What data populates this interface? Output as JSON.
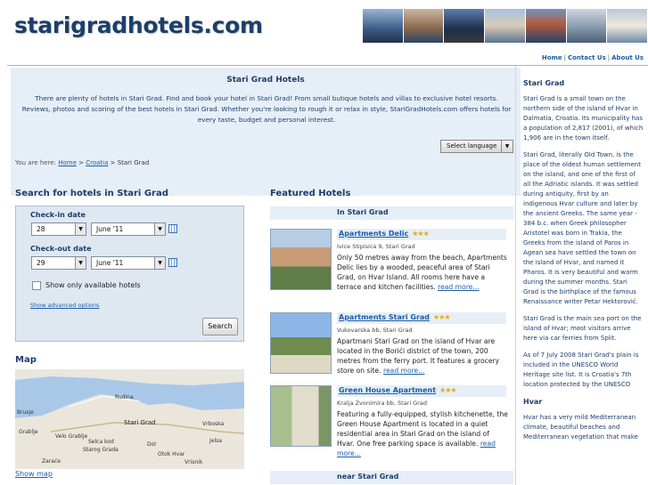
{
  "header": {
    "logo": "starigradhotels.com",
    "nav": [
      "Home",
      "Contact Us",
      "About Us"
    ]
  },
  "intro": {
    "title": "Stari Grad Hotels",
    "text": "There are plenty of hotels in Stari Grad. Find and book your hotel in Stari Grad! From small butique hotels and villas to exclusive hotel resorts. Reviews, photos and scoring of the best hotels in Stari Grad. Whether you're looking to rough it or relax in style, StariGradHotels.com offers hotels for every taste, budget and personal interest."
  },
  "language": {
    "label": "Select language"
  },
  "breadcrumb": {
    "label": "You are here:",
    "home": "Home",
    "country": "Croatia",
    "current": "Stari Grad"
  },
  "search": {
    "title": "Search for hotels in Stari Grad",
    "checkin_label": "Check-in date",
    "checkin_day": "28",
    "checkin_month": "June '11",
    "checkout_label": "Check-out date",
    "checkout_day": "29",
    "checkout_month": "June '11",
    "available_label": "Show only available hotels",
    "advanced_link": "Show advanced options",
    "button": "Search"
  },
  "map": {
    "title": "Map",
    "labels": [
      "Rudina",
      "Brusje",
      "Stari Grad",
      "Vrboska",
      "Grablje",
      "Velo Grablje",
      "Selca kod",
      "Starog Grada",
      "Dol",
      "Jelsa",
      "Otok Hvar",
      "Zaraće",
      "Vrisnik"
    ],
    "show_link": "Show map"
  },
  "featured": {
    "title": "Featured Hotels",
    "in_label": "In Stari Grad",
    "near_label": "near Stari Grad",
    "hotels": [
      {
        "name": "Apartments Delic",
        "stars": "★★★",
        "address": "Ivice Stipisica 9, Stari Grad",
        "desc": "Only 50 metres away from the beach, Apartments Delic lies by a wooded, peaceful area of Stari Grad, on Hvar Island. All rooms here have a terrace and kitchen facilities.",
        "more": "read more..."
      },
      {
        "name": "Apartments Stari Grad",
        "stars": "★★★",
        "address": "Vukovarska bb, Stari Grad",
        "desc": "Apartmani Stari Grad on the island of Hvar are located in the Borići district of the town, 200 metres from the ferry port. It features a grocery store on site.",
        "more": "read more..."
      },
      {
        "name": "Green House Apartment",
        "stars": "★★★",
        "address": "Kralja Zvonimira bb, Stari Grad",
        "desc": "Featuring a fully-equipped, stylish kitchenette, the Green House Apartment is located in a quiet residential area in Stari Grad on the island of Hvar. One free parking space is available.",
        "more": "read more..."
      }
    ]
  },
  "sidebar": {
    "title1": "Stari Grad",
    "p1": "Stari Grad is a small town on the northern side of the island of Hvar in Dalmatia, Croatia. Its municipality has a population of 2,817 (2001), of which 1,906 are in the town itself.",
    "p2": "Stari Grad, literally Old Town, is the place of the oldest human settlement on the island, and one of the first of all the Adriatic islands. It was settled during antiquity, first by an indigenous Hvar culture and later by the ancient Greeks. The same year - 384 b.c. when Greek philosopher Aristotel was born in Trakia, the Greeks from the island of Paros in Agean sea have settled the town on the island of Hvar, and named it Pharos. It is very beautiful and warm during the summer months. Stari Grad is the birthplace of the famous Renaissance writer Petar Hektorović.",
    "p3": "Stari Grad is the main sea port on the island of Hvar; most visitors arrive here via car ferries from Split.",
    "p4": "As of 7 July 2008 Stari Grad's plain is included in the UNESCO World Heritage site list. It is Croatia's 7th location protected by the UNESCO",
    "title2": "Hvar",
    "p5": "Hvar has a very mild Mediterranean climate, beautiful beaches and Mediterranean vegetation that make"
  }
}
